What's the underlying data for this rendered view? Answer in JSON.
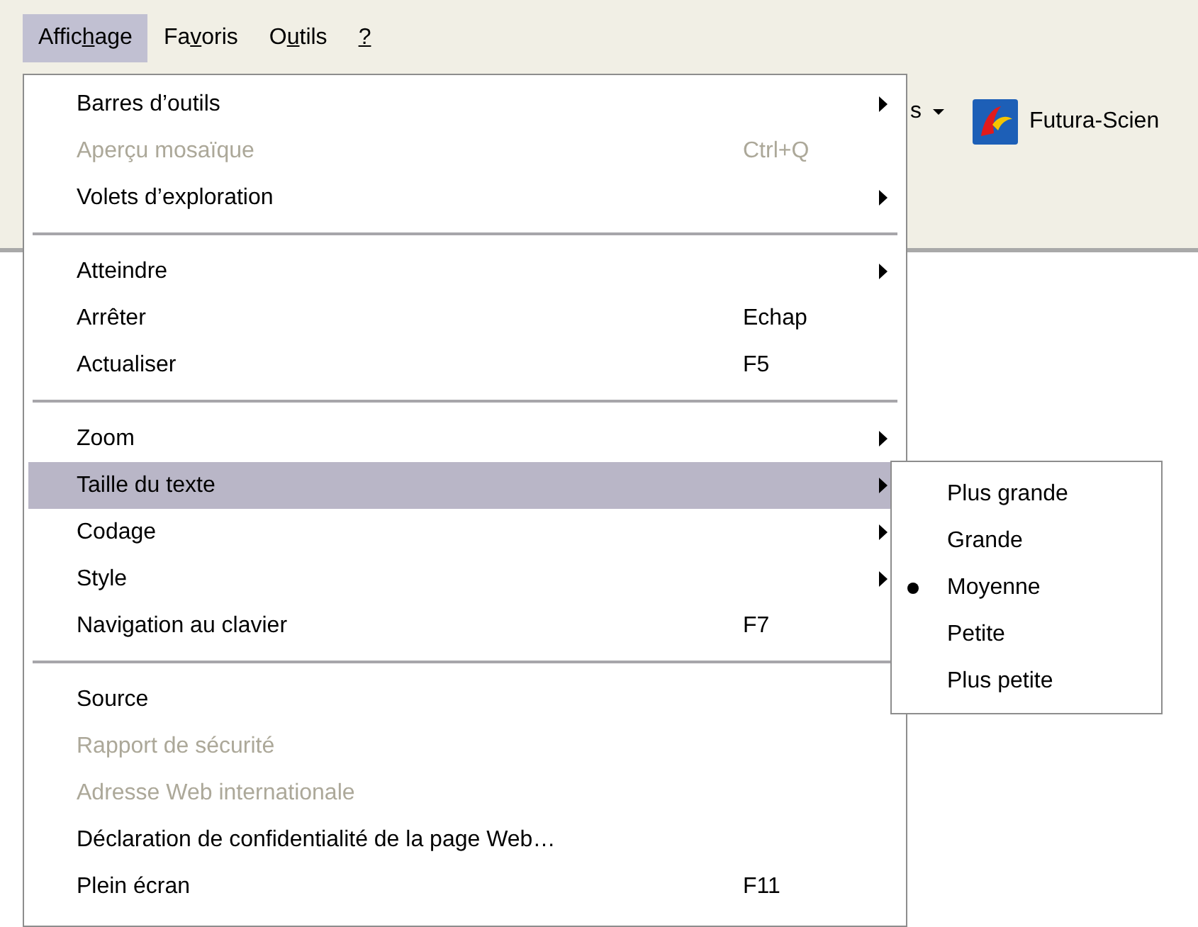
{
  "menubar": [
    {
      "before": "Affic",
      "key": "h",
      "after": "age",
      "selected": true
    },
    {
      "before": "Fa",
      "key": "v",
      "after": "oris",
      "selected": false
    },
    {
      "before": "O",
      "key": "u",
      "after": "tils",
      "selected": false
    },
    {
      "key": "?",
      "selected": false
    }
  ],
  "toolbar": [
    {
      "kind": "dropdown",
      "label": "s"
    },
    {
      "kind": "link",
      "label": "Futura-Scien"
    }
  ],
  "menu": {
    "sections": [
      [
        {
          "label": "Barres d’outils",
          "submenu": true,
          "disabled": false,
          "selected": false
        },
        {
          "label": "Aperçu mosaïque",
          "shortcut": "Ctrl+Q",
          "submenu": false,
          "disabled": true,
          "selected": false
        },
        {
          "label": "Volets d’exploration",
          "submenu": true,
          "disabled": false,
          "selected": false
        }
      ],
      [
        {
          "label": "Atteindre",
          "submenu": true,
          "disabled": false,
          "selected": false
        },
        {
          "label": "Arrêter",
          "shortcut": "Echap",
          "submenu": false,
          "disabled": false,
          "selected": false
        },
        {
          "label": "Actualiser",
          "shortcut": "F5",
          "submenu": false,
          "disabled": false,
          "selected": false
        }
      ],
      [
        {
          "label": "Zoom",
          "submenu": true,
          "disabled": false,
          "selected": false
        },
        {
          "label": "Taille du texte",
          "submenu": true,
          "disabled": false,
          "selected": true
        },
        {
          "label": "Codage",
          "submenu": true,
          "disabled": false,
          "selected": false
        },
        {
          "label": "Style",
          "submenu": true,
          "disabled": false,
          "selected": false
        },
        {
          "label": "Navigation au clavier",
          "shortcut": "F7",
          "submenu": false,
          "disabled": false,
          "selected": false
        }
      ],
      [
        {
          "label": "Source",
          "submenu": false,
          "disabled": false,
          "selected": false
        },
        {
          "label": "Rapport de sécurité",
          "submenu": false,
          "disabled": true,
          "selected": false
        },
        {
          "label": "Adresse Web internationale",
          "submenu": false,
          "disabled": true,
          "selected": false
        },
        {
          "label": "Déclaration de confidentialité de la page Web…",
          "submenu": false,
          "disabled": false,
          "selected": false
        },
        {
          "label": "Plein écran",
          "shortcut": "F11",
          "submenu": false,
          "disabled": false,
          "selected": false
        }
      ]
    ]
  },
  "submenu": {
    "items": [
      {
        "label": "Plus grande",
        "selected": false
      },
      {
        "label": "Grande",
        "selected": false
      },
      {
        "label": "Moyenne",
        "selected": true
      },
      {
        "label": "Petite",
        "selected": false
      },
      {
        "label": "Plus petite",
        "selected": false
      }
    ]
  }
}
